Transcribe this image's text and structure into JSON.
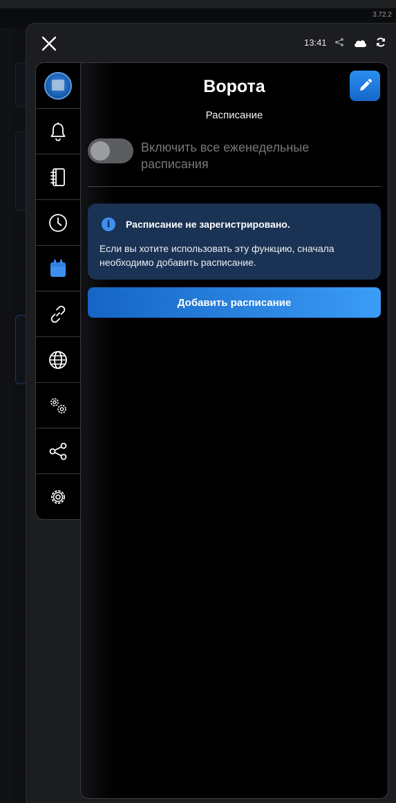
{
  "app": {
    "version": "3.72.2"
  },
  "header": {
    "time": "13:41",
    "icons": [
      "close-icon",
      "share-icon",
      "cloud-icon",
      "sync-icon"
    ]
  },
  "sidebar": {
    "items": [
      {
        "name": "device-avatar",
        "icon": "device-icon"
      },
      {
        "name": "notifications",
        "icon": "bell-icon"
      },
      {
        "name": "journal",
        "icon": "notebook-icon"
      },
      {
        "name": "timer",
        "icon": "clock-icon"
      },
      {
        "name": "schedule",
        "icon": "calendar-icon",
        "active": true
      },
      {
        "name": "links",
        "icon": "link-icon"
      },
      {
        "name": "network",
        "icon": "globe-icon"
      },
      {
        "name": "advanced-settings",
        "icon": "gears-icon"
      },
      {
        "name": "share",
        "icon": "share-icon"
      },
      {
        "name": "settings",
        "icon": "gear-icon"
      }
    ]
  },
  "main": {
    "title": "Ворота",
    "subtitle": "Расписание",
    "toggle": {
      "label": "Включить все еженедельные расписания",
      "enabled": false
    },
    "info": {
      "title": "Расписание не зарегистрировано.",
      "text": "Если вы хотите использовать эту функцию, сначала необходимо добавить расписание."
    },
    "add_button": "Добавить расписание"
  },
  "colors": {
    "accent": "#2a8ef0",
    "info_bg": "#1a3253",
    "active_icon": "#3d8ff0"
  }
}
